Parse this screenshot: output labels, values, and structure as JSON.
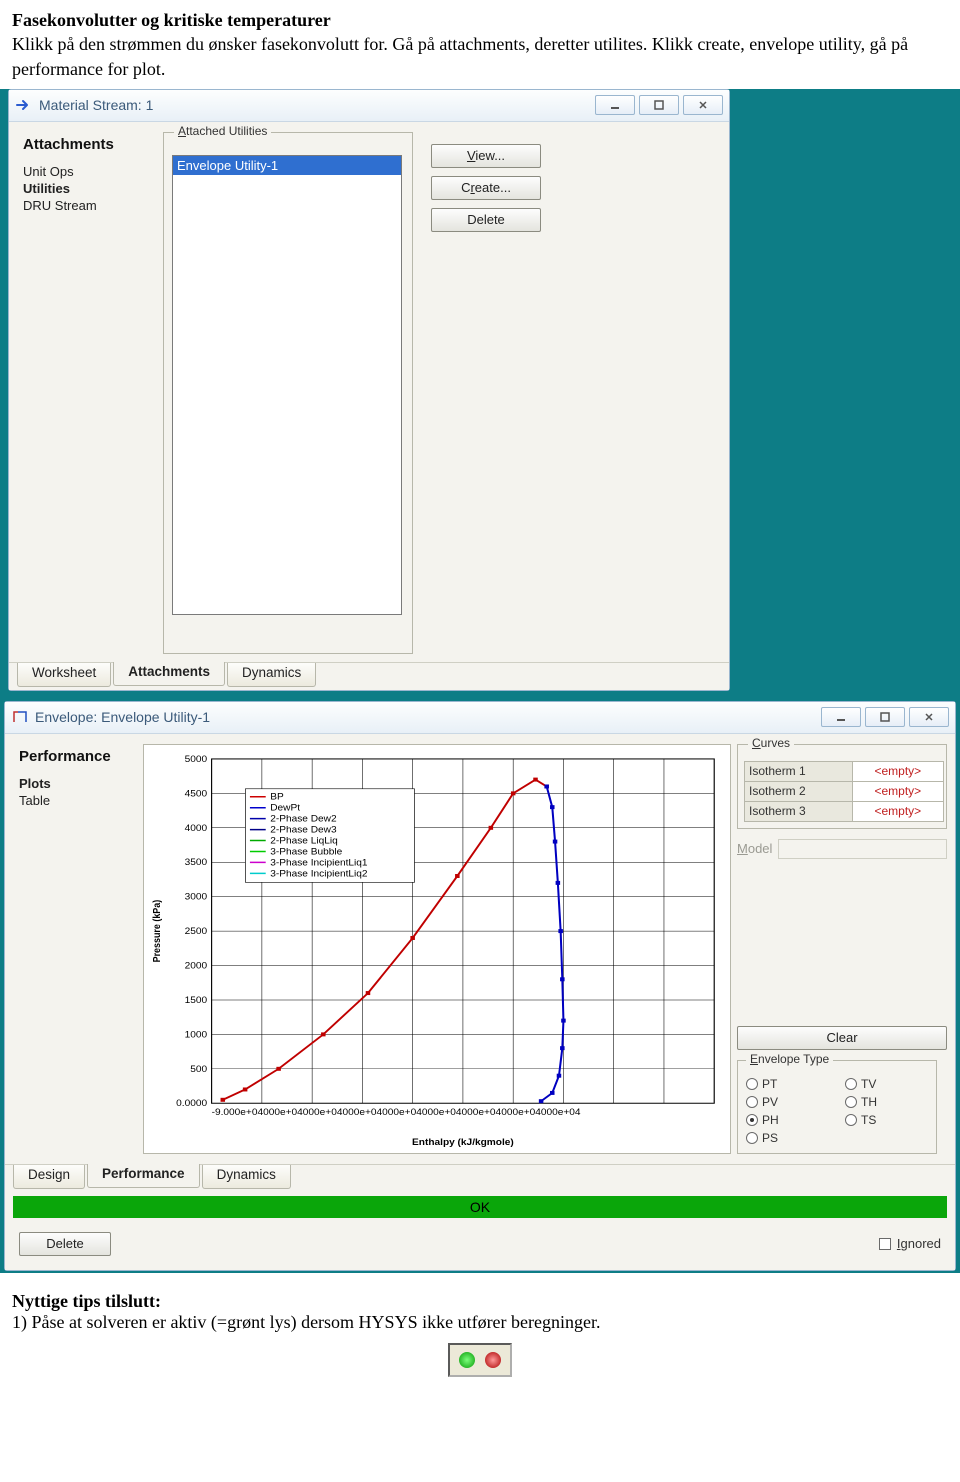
{
  "doc": {
    "heading": "Fasekonvolutter og kritiske temperaturer",
    "body": "Klikk på den strømmen du ønsker fasekonvolutt for. Gå på attachments, deretter utilites. Klikk create, envelope utility, gå på performance for plot."
  },
  "win1": {
    "title": "Material Stream: 1",
    "side_heading": "Attachments",
    "side_items": [
      "Unit Ops",
      "Utilities",
      "DRU Stream"
    ],
    "bold_index": 1,
    "group_label": "Attached Utilities",
    "group_underline": "A",
    "list_item": "Envelope Utility-1",
    "buttons": {
      "view": "View...",
      "create": "Create...",
      "delete": "Delete"
    },
    "view_ul": "V",
    "create_ul": "r",
    "tabs": [
      "Worksheet",
      "Attachments",
      "Dynamics"
    ],
    "active_tab": 1
  },
  "win2": {
    "title": "Envelope: Envelope Utility-1",
    "side_heading": "Performance",
    "side_items": [
      "Plots",
      "Table"
    ],
    "bold_index": 0,
    "curves_label": "Curves",
    "curves_ul": "C",
    "curves": [
      {
        "label": "Isotherm 1",
        "value": "<empty>"
      },
      {
        "label": "Isotherm 2",
        "value": "<empty>"
      },
      {
        "label": "Isotherm 3",
        "value": "<empty>"
      }
    ],
    "model_label": "Model",
    "model_ul": "M",
    "clear_label": "Clear",
    "env_type_label": "Envelope Type",
    "env_type_ul": "E",
    "env_types": [
      "PT",
      "TV",
      "PV",
      "TH",
      "PH",
      "TS",
      "PS"
    ],
    "env_selected": "PH",
    "tabs": [
      "Design",
      "Performance",
      "Dynamics"
    ],
    "active_tab": 1,
    "ok_label": "OK",
    "delete_label": "Delete",
    "ignored_label": "Ignored",
    "ignored_ul": "I",
    "xlabel": "Enthalpy (kJ/kgmole)",
    "ylabel": "Pressure (kPa)",
    "legend_items": [
      "BP",
      "DewPt",
      "2-Phase Dew2",
      "2-Phase Dew3",
      "2-Phase LiqLiq",
      "3-Phase Bubble",
      "3-Phase IncipientLiq1",
      "3-Phase IncipientLiq2"
    ],
    "legend_colors": [
      "#c00",
      "#00c",
      "#00a",
      "#008",
      "#0a0",
      "#0c0",
      "#c0c",
      "#0cc"
    ]
  },
  "footer": {
    "heading": "Nyttige tips tilslutt:",
    "line": "1) Påse at solveren er aktiv (=grønt lys) dersom HYSYS ikke utfører beregninger."
  },
  "chart_data": {
    "type": "line",
    "title": "",
    "xlabel": "Enthalpy (kJ/kgmole)",
    "ylabel": "Pressure (kPa)",
    "ylim": [
      0,
      5000
    ],
    "yticks": [
      0,
      500,
      1000,
      1500,
      2000,
      2500,
      3000,
      3500,
      4000,
      4500,
      5000
    ],
    "xlim": [
      -90000,
      0
    ],
    "xticks_label": "-9.000e+004",
    "series": [
      {
        "name": "BP",
        "color": "#c00000",
        "x": [
          -88000,
          -84000,
          -78000,
          -70000,
          -62000,
          -54000,
          -46000,
          -40000,
          -36000,
          -32000,
          -30000
        ],
        "y": [
          50,
          200,
          500,
          1000,
          1600,
          2400,
          3300,
          4000,
          4500,
          4700,
          4600
        ]
      },
      {
        "name": "DewPt",
        "color": "#0000c0",
        "x": [
          -30000,
          -29000,
          -28500,
          -28000,
          -27500,
          -27200,
          -27000,
          -27200,
          -27800,
          -29000,
          -31000
        ],
        "y": [
          4600,
          4300,
          3800,
          3200,
          2500,
          1800,
          1200,
          800,
          400,
          150,
          30
        ]
      }
    ]
  }
}
